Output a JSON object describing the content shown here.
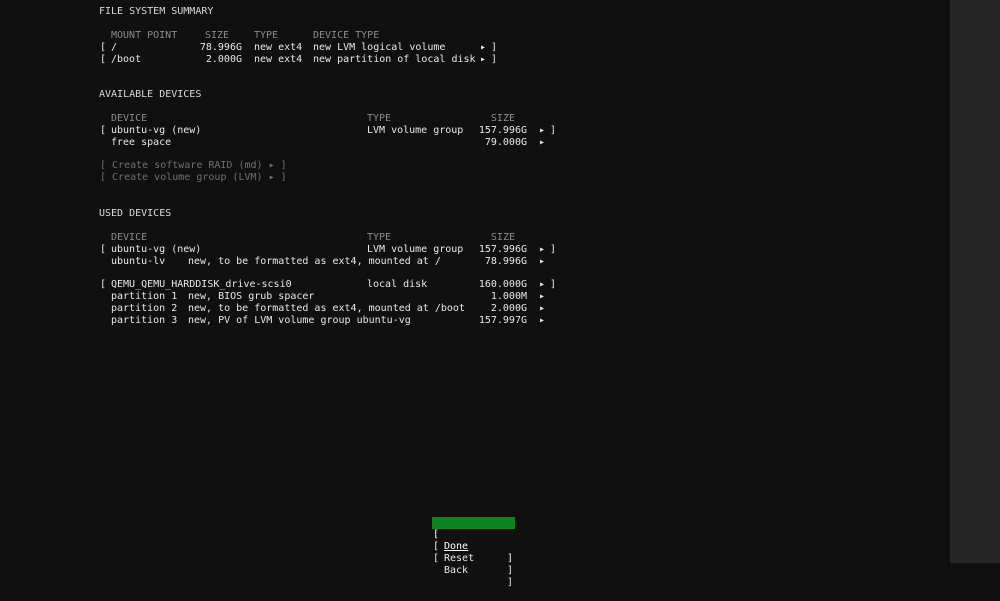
{
  "fs_summary": {
    "title": "FILE SYSTEM SUMMARY",
    "headers": {
      "mount": "MOUNT POINT",
      "size": "SIZE",
      "type": "TYPE",
      "device_type": "DEVICE TYPE"
    },
    "rows": [
      {
        "open": "[",
        "mount": "/",
        "size": "78.996G",
        "type": "new ext4",
        "device_type": "new LVM logical volume",
        "arrow": "▸",
        "close": "]"
      },
      {
        "open": "[",
        "mount": "/boot",
        "size": "2.000G",
        "type": "new ext4",
        "device_type": "new partition of local disk",
        "arrow": "▸",
        "close": "]"
      }
    ]
  },
  "available": {
    "title": "AVAILABLE DEVICES",
    "headers": {
      "device": "DEVICE",
      "type": "TYPE",
      "size": "SIZE"
    },
    "rows": [
      {
        "open": "[",
        "device": "ubuntu-vg (new)",
        "type": "LVM volume group",
        "size": "157.996G",
        "arrow": "▸",
        "close": "]"
      },
      {
        "device": "free space",
        "size": "79.000G",
        "arrow": "▸"
      }
    ],
    "actions": [
      "[ Create software RAID (md) ▸ ]",
      "[ Create volume group (LVM) ▸ ]"
    ]
  },
  "used": {
    "title": "USED DEVICES",
    "headers": {
      "device": "DEVICE",
      "type": "TYPE",
      "size": "SIZE"
    },
    "vg": {
      "open": "[",
      "device": "ubuntu-vg (new)",
      "type": "LVM volume group",
      "size": "157.996G",
      "arrow": "▸",
      "close": "]"
    },
    "vg_children": [
      {
        "name": "ubuntu-lv",
        "desc": "new, to be formatted as ext4, mounted at /",
        "size": "78.996G",
        "arrow": "▸"
      }
    ],
    "disk": {
      "open": "[",
      "device": "QEMU_QEMU_HARDDISK_drive-scsi0",
      "type": "local disk",
      "size": "160.000G",
      "arrow": "▸",
      "close": "]"
    },
    "disk_children": [
      {
        "name": "partition 1",
        "desc": "new, BIOS grub spacer",
        "size": "1.000M",
        "arrow": "▸"
      },
      {
        "name": "partition 2",
        "desc": "new, to be formatted as ext4, mounted at /boot",
        "size": "2.000G",
        "arrow": "▸"
      },
      {
        "name": "partition 3",
        "desc": "new, PV of LVM volume group ubuntu-vg",
        "size": "157.997G",
        "arrow": "▸"
      }
    ]
  },
  "buttons": {
    "open": "[",
    "close": "]",
    "done": "Done",
    "reset": "Reset",
    "back": "Back"
  },
  "colors": {
    "background": "#101010",
    "selected_button": "#0e8420",
    "side_strip": "#262626"
  }
}
